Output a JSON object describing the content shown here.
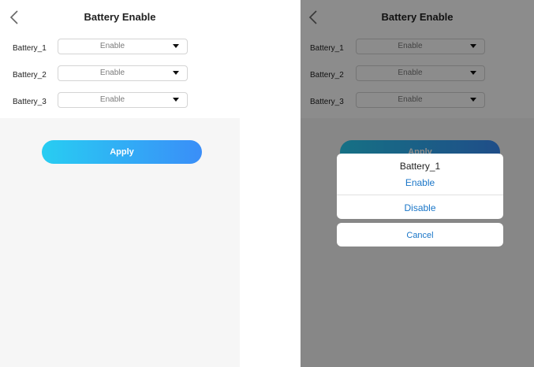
{
  "screens": [
    {
      "header": {
        "title": "Battery Enable",
        "back_icon": "chevron-left-icon"
      },
      "batteries": [
        {
          "label": "Battery_1",
          "value": "Enable"
        },
        {
          "label": "Battery_2",
          "value": "Enable"
        },
        {
          "label": "Battery_3",
          "value": "Enable"
        }
      ],
      "apply_label": "Apply"
    },
    {
      "header": {
        "title": "Battery Enable",
        "back_icon": "chevron-left-icon"
      },
      "batteries": [
        {
          "label": "Battery_1",
          "value": "Enable"
        },
        {
          "label": "Battery_2",
          "value": "Enable"
        },
        {
          "label": "Battery_3",
          "value": "Enable"
        }
      ],
      "apply_label": "Apply",
      "action_sheet": {
        "title": "Battery_1",
        "options": [
          "Enable",
          "Disable"
        ],
        "cancel_label": "Cancel"
      }
    }
  ],
  "colors": {
    "accent_start": "#28cdf2",
    "accent_end": "#3a8ef8",
    "link": "#1a76c8",
    "overlay": "rgba(0,0,0,0.45)"
  }
}
